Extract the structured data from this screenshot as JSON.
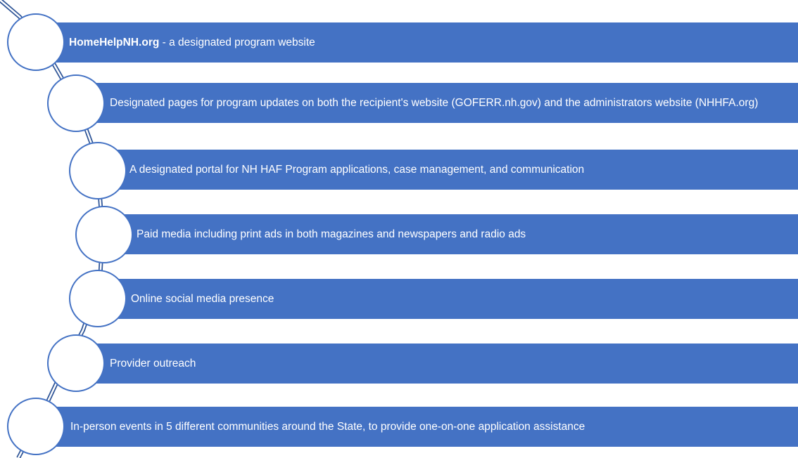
{
  "colors": {
    "bar_fill": "#4472c4",
    "circle_fill": "#ffffff",
    "circle_stroke": "#4472c4",
    "connector_stroke": "#2f5597"
  },
  "items": [
    {
      "bold": "HomeHelpNH.org",
      "text": " - a designated program website"
    },
    {
      "bold": "",
      "text": "Designated pages for program updates on both the recipient's website (GOFERR.nh.gov) and the administrators website (NHHFA.org)"
    },
    {
      "bold": "",
      "text": "A designated portal for NH HAF Program applications, case management, and communication"
    },
    {
      "bold": "",
      "text": "Paid media including print ads in both magazines and newspapers and radio ads"
    },
    {
      "bold": "",
      "text": "Online social media presence"
    },
    {
      "bold": "",
      "text": "Provider outreach"
    },
    {
      "bold": "",
      "text": "In-person events in 5 different communities around the State, to provide one-on-one application assistance"
    }
  ]
}
